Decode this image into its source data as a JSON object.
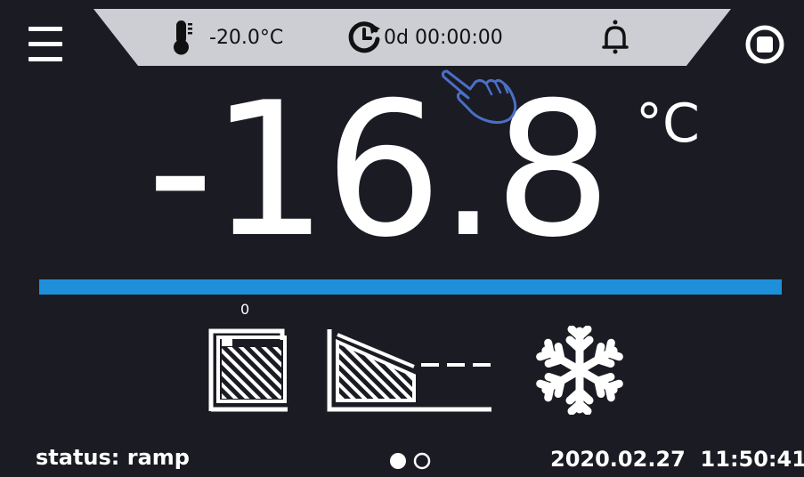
{
  "header": {
    "setpoint_temp": "-20.0°C",
    "timer": "0d 00:00:00"
  },
  "main": {
    "current_temp": "-16.8",
    "unit": "°C",
    "progress_label": "0",
    "progress_fraction": 1.0,
    "accent_color": "#1e8fd9"
  },
  "icons": {
    "menu": "menu-icon",
    "thermometer": "thermometer-icon",
    "timer": "timer-icon",
    "alarm": "bell-icon",
    "stop": "stop-icon",
    "touch": "hand-pointer-icon",
    "chamber": "chamber-icon",
    "ramp": "ramp-profile-icon",
    "cooling": "snowflake-icon"
  },
  "footer": {
    "status": "status: ramp",
    "datetime": "2020.02.27  11:50:41",
    "page_indicator": {
      "pages": 2,
      "current": 1
    }
  }
}
